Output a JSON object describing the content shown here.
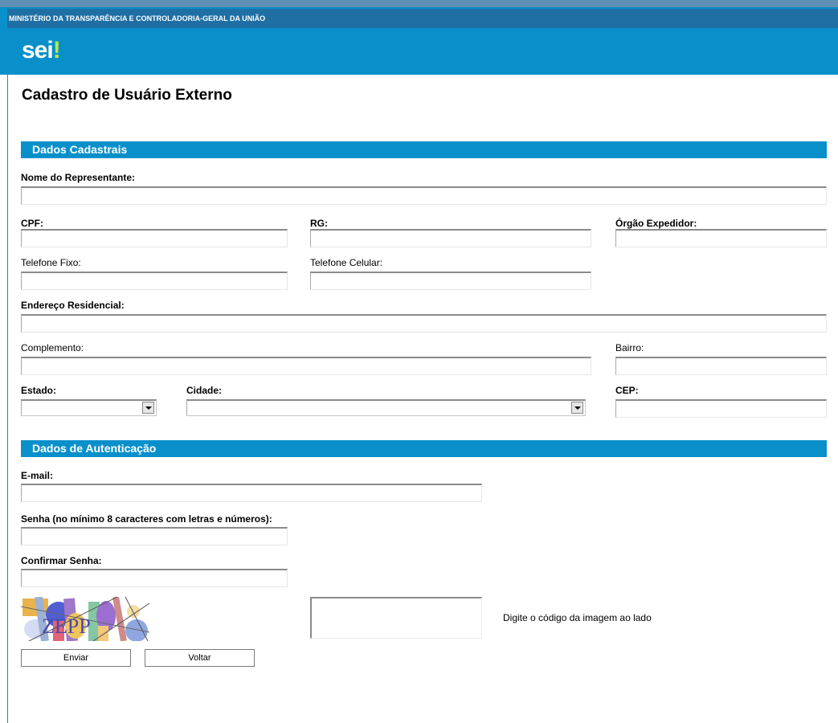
{
  "header": {
    "ministry": "MINISTÉRIO DA TRANSPARÊNCIA E CONTROLADORIA-GERAL DA UNIÃO",
    "logo_text": "sei",
    "logo_mark": "!"
  },
  "page_title": "Cadastro de Usuário Externo",
  "sections": {
    "cadastrais": "Dados Cadastrais",
    "autenticacao": "Dados de Autenticação"
  },
  "labels": {
    "nome": "Nome do Representante:",
    "cpf": "CPF:",
    "rg": "RG:",
    "orgao": "Órgão Expedidor:",
    "telefone_fixo": "Telefone Fixo:",
    "telefone_celular": "Telefone Celular:",
    "endereco": "Endereço Residencial:",
    "complemento": "Complemento:",
    "bairro": "Bairro:",
    "estado": "Estado:",
    "cidade": "Cidade:",
    "cep": "CEP:",
    "email": "E-mail:",
    "senha": "Senha (no mínimo 8 caracteres com letras e números):",
    "confirmar_senha": "Confirmar Senha:",
    "captcha_hint": "Digite o código da imagem ao lado"
  },
  "captcha": {
    "code": "ZEPP"
  },
  "buttons": {
    "enviar": "Enviar",
    "voltar": "Voltar"
  },
  "colors": {
    "header_blue": "#0990cb",
    "ministry_bar": "#1f6fa5",
    "logo_accent": "#b8e94a"
  }
}
